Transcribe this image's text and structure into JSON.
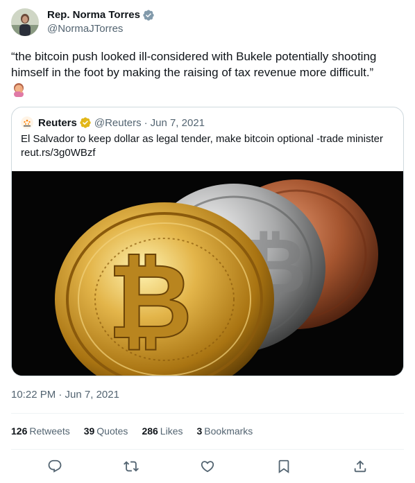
{
  "author": {
    "name": "Rep. Norma Torres",
    "handle": "@NormaJTorres",
    "verified_icon": "verified-badge-icon"
  },
  "tweet": {
    "text": "“the bitcoin push looked ill-considered with Bukele potentially shooting himself in the foot by making the raising of tax revenue more difficult.”",
    "emoji": "face-palm-woman-emoji"
  },
  "quote": {
    "name": "Reuters",
    "handle": "@Reuters",
    "separator": "·",
    "date": "Jun 7, 2021",
    "text_line1": "El Salvador to keep dollar as legal tender, make bitcoin optional -trade minister",
    "text_line2": "reut.rs/3g0WBzf",
    "image": "bitcoin-coins-photo"
  },
  "timestamp": "10:22 PM · Jun 7, 2021",
  "stats": {
    "retweets_count": "126",
    "retweets_label": "Retweets",
    "quotes_count": "39",
    "quotes_label": "Quotes",
    "likes_count": "286",
    "likes_label": "Likes",
    "bookmarks_count": "3",
    "bookmarks_label": "Bookmarks"
  },
  "actions": [
    "reply-icon",
    "retweet-icon",
    "like-icon",
    "bookmark-icon",
    "share-icon"
  ],
  "colors": {
    "text": "#0f1419",
    "muted": "#536471",
    "border": "#cfd9de",
    "verified_blue": "#1d9bf0",
    "verified_gold": "#e2b719"
  }
}
